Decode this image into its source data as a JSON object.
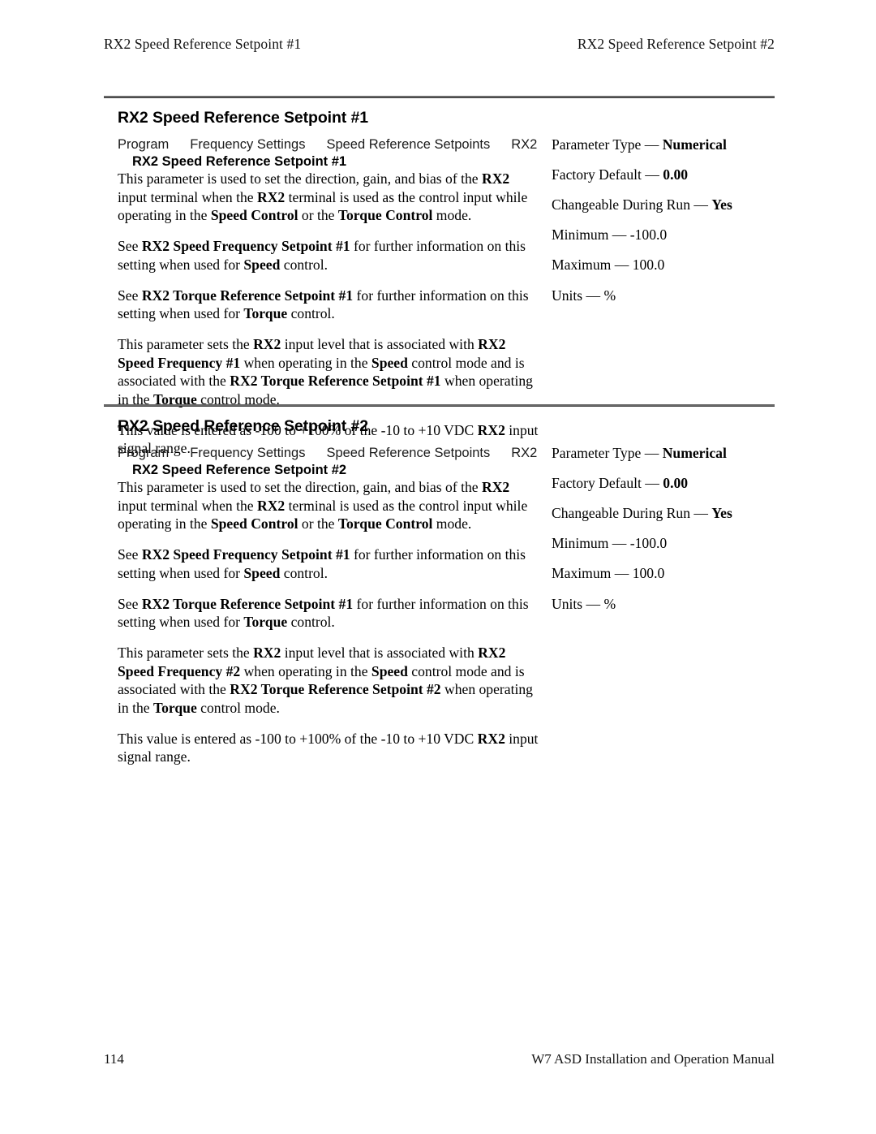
{
  "running_header": {
    "left": "RX2 Speed Reference Setpoint #1",
    "right": "RX2 Speed Reference Setpoint #2"
  },
  "sections": [
    {
      "title": "RX2 Speed Reference Setpoint #1",
      "breadcrumb": {
        "items": [
          "Program",
          "Frequency Settings",
          "Speed Reference Setpoints",
          "RX2"
        ],
        "last": "RX2 Speed Reference Setpoint #1"
      },
      "paragraphs": [
        "This parameter is used to set the direction, gain, and bias of the <b>RX2</b> input terminal when the <b>RX2</b> terminal is used as the control input while operating in the <b>Speed Control</b> or the <b>Torque Control</b> mode.",
        "See <b>RX2 Speed Frequency Setpoint #1</b> for further information on this setting when used for <b>Speed</b> control.",
        "See <b>RX2 Torque Reference Setpoint #1</b> for further information on this setting when used for <b>Torque</b> control.",
        "This parameter sets the <b>RX2</b> input level that is associated with <b>RX2 Speed Frequency #1</b> when operating in the <b>Speed</b> control mode and is associated with the <b>RX2 Torque Reference Setpoint #1</b> when operating in the <b>Torque</b> control mode.",
        "This value is entered as -100 to +100% of the -10 to +10 VDC <b>RX2</b> input signal range."
      ],
      "specs": [
        {
          "label": "Parameter Type",
          "dash": "—",
          "value": "Numerical",
          "bold": true
        },
        {
          "label": "Factory Default",
          "dash": "—",
          "value": "0.00",
          "bold": true
        },
        {
          "label": "Changeable During Run",
          "dash": "—",
          "value": "Yes",
          "bold": true
        },
        {
          "label": "Minimum",
          "dash": "—",
          "value": "-100.0",
          "bold": false
        },
        {
          "label": "Maximum",
          "dash": "—",
          "value": "100.0",
          "bold": false
        },
        {
          "label": "Units",
          "dash": "—",
          "value": "%",
          "bold": false
        }
      ]
    },
    {
      "title": "RX2 Speed Reference Setpoint #2",
      "breadcrumb": {
        "items": [
          "Program",
          "Frequency Settings",
          "Speed Reference Setpoints",
          "RX2"
        ],
        "last": "RX2 Speed Reference Setpoint #2"
      },
      "paragraphs": [
        "This parameter is used to set the direction, gain, and bias of the <b>RX2</b> input terminal when the <b>RX2</b> terminal is used as the control input while operating in the <b>Speed Control</b> or the <b>Torque Control</b> mode.",
        "See <b>RX2 Speed Frequency Setpoint #1</b> for further information on this setting when used for <b>Speed</b> control.",
        "See <b>RX2 Torque Reference Setpoint #1</b> for further information on this setting when used for <b>Torque</b> control.",
        "This parameter sets the <b>RX2</b> input level that is associated with <b>RX2 Speed Frequency #2</b> when operating in the <b>Speed</b> control mode and is associated with the <b>RX2 Torque Reference Setpoint #2</b> when operating in the <b>Torque</b> control mode.",
        "This value is entered as -100 to +100% of the -10 to +10 VDC <b>RX2</b> input signal range."
      ],
      "specs": [
        {
          "label": "Parameter Type",
          "dash": "—",
          "value": "Numerical",
          "bold": true
        },
        {
          "label": "Factory Default",
          "dash": "—",
          "value": "0.00",
          "bold": true
        },
        {
          "label": "Changeable During Run",
          "dash": "—",
          "value": "Yes",
          "bold": true
        },
        {
          "label": "Minimum",
          "dash": "—",
          "value": "-100.0",
          "bold": false
        },
        {
          "label": "Maximum",
          "dash": "—",
          "value": "100.0",
          "bold": false
        },
        {
          "label": "Units",
          "dash": "—",
          "value": "%",
          "bold": false
        }
      ]
    }
  ],
  "footer": {
    "page_number": "114",
    "manual_title": "W7 ASD Installation and Operation Manual"
  }
}
